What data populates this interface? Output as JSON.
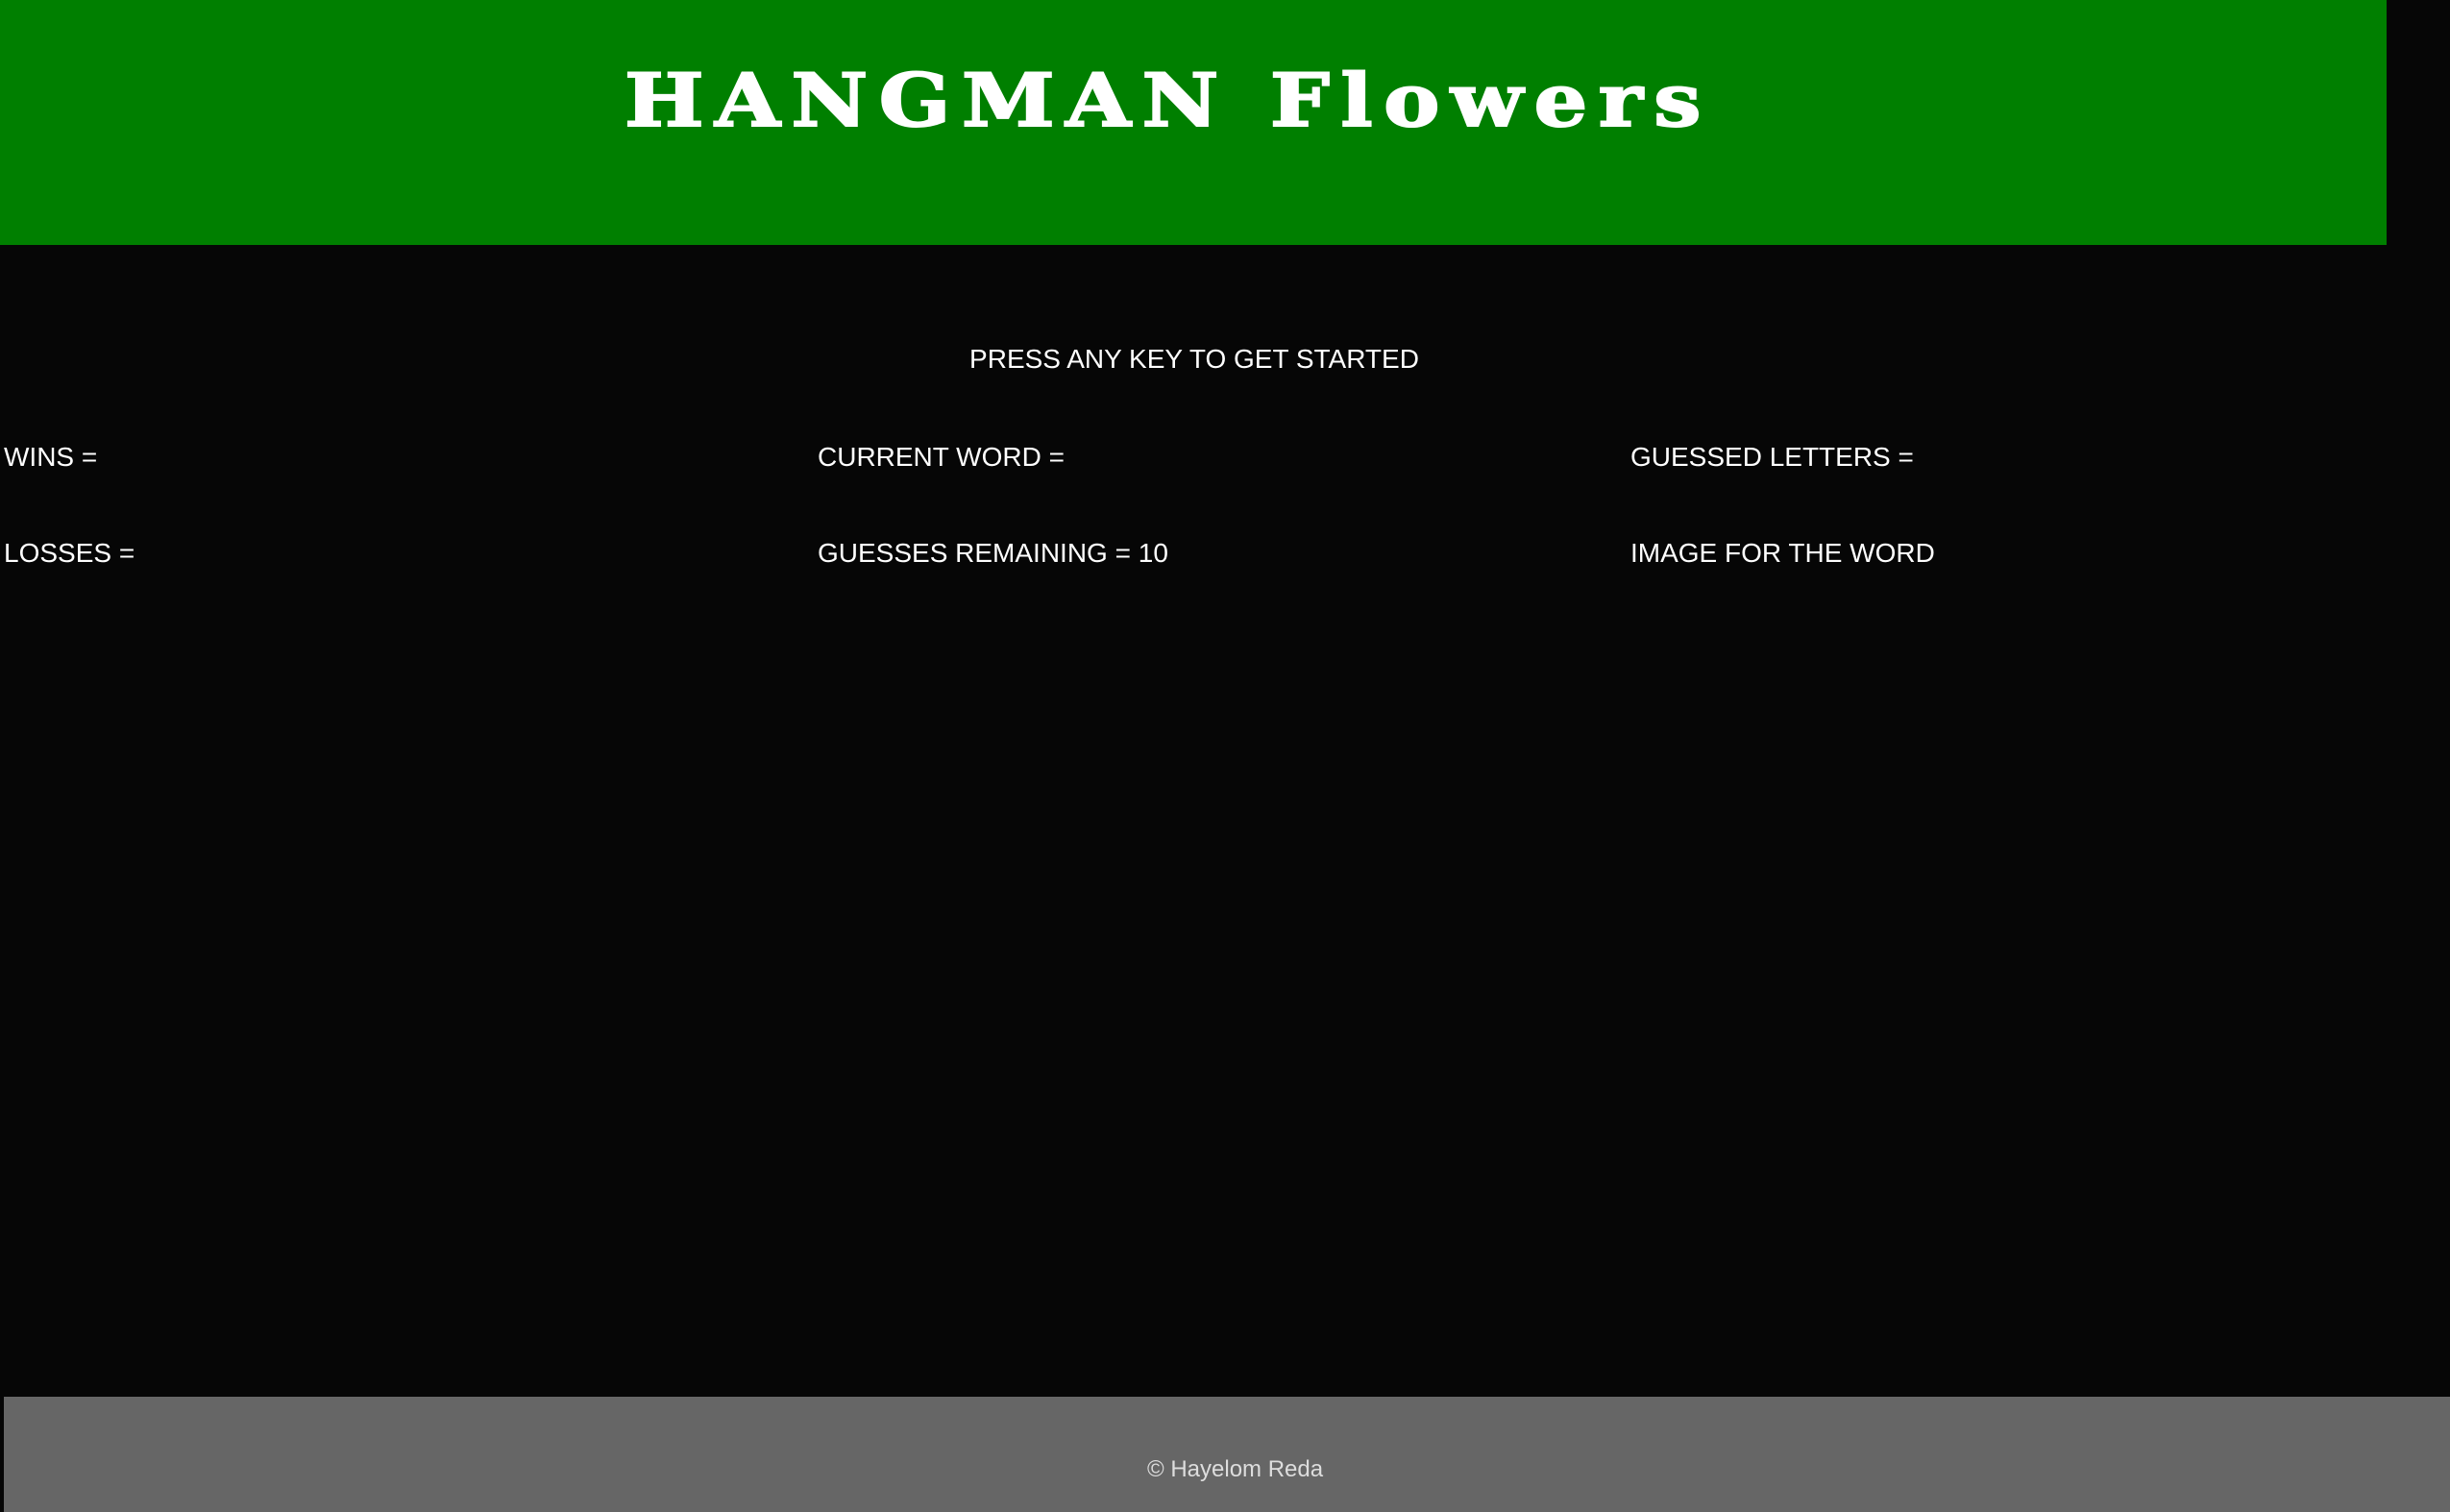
{
  "header": {
    "title": "HANGMAN Flowers"
  },
  "game": {
    "prompt": "PRESS ANY KEY TO GET STARTED",
    "wins_label": "WINS =",
    "losses_label": "LOSSES =",
    "current_word_label": "CURRENT WORD =",
    "guesses_remaining_label": "GUESSES REMAINING = 10",
    "guessed_letters_label": "GUESSED LETTERS =",
    "image_label": "IMAGE FOR THE WORD"
  },
  "footer": {
    "copyright": "© Hayelom Reda"
  },
  "colors": {
    "header_bg": "#007f00",
    "page_bg": "#060606",
    "footer_bg": "#666666",
    "text": "#ffffff"
  }
}
